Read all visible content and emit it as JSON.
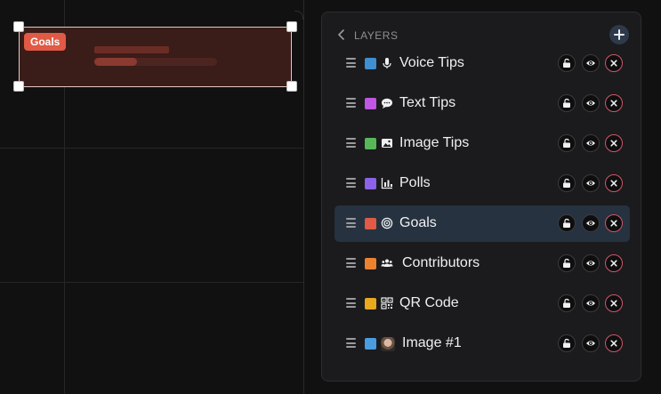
{
  "canvas": {
    "widget": {
      "badge": "Goals",
      "progress_fraction": 0.35,
      "color": "#e05a45"
    }
  },
  "layers_panel": {
    "back_icon": "chevron-left-icon",
    "title": "LAYERS",
    "add_icon": "plus-icon",
    "items": [
      {
        "name": "Voice Tips",
        "color": "#3f8fd1",
        "icon": "microphone-icon",
        "selected": false
      },
      {
        "name": "Text Tips",
        "color": "#c056e4",
        "icon": "chat-bubble-icon",
        "selected": false
      },
      {
        "name": "Image Tips",
        "color": "#57b85a",
        "icon": "image-icon",
        "selected": false
      },
      {
        "name": "Polls",
        "color": "#8a63e8",
        "icon": "bar-chart-icon",
        "selected": false
      },
      {
        "name": "Goals",
        "color": "#e05a45",
        "icon": "target-icon",
        "selected": true
      },
      {
        "name": "Contributors",
        "color": "#ec8230",
        "icon": "users-icon",
        "selected": false
      },
      {
        "name": "QR Code",
        "color": "#e8a820",
        "icon": "qr-code-icon",
        "selected": false
      },
      {
        "name": "Image #1",
        "color": "#4a9ce0",
        "icon": "photo-thumbnail-icon",
        "selected": false
      }
    ],
    "row_actions": [
      "unlock-icon",
      "eye-icon",
      "close-icon"
    ]
  }
}
